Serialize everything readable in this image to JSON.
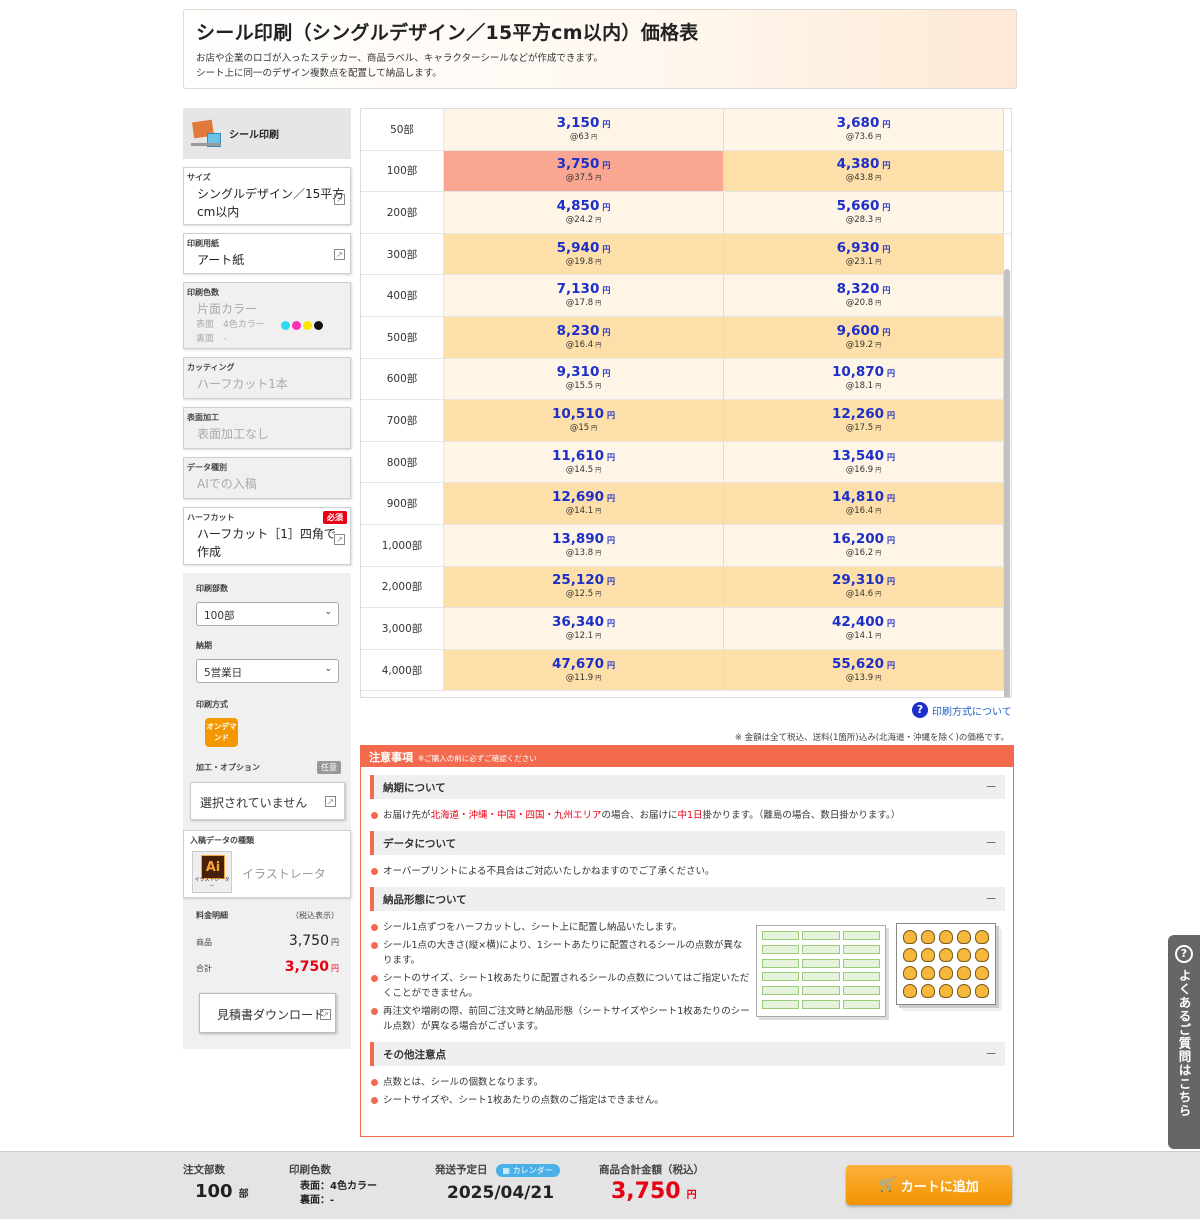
{
  "header": {
    "title": "シール印刷（シングルデザイン／15平方cm以内）価格表",
    "desc1": "お店や企業のロゴが入ったステッカー、商品ラベル、キャラクターシールなどが作成できます。",
    "desc2": "シート上に同一のデザイン複数点を配置して納品します。"
  },
  "sidebar": {
    "title": "シール印刷",
    "size_cap": "サイズ",
    "size_val": "シングルデザイン／15平方cm以内",
    "paper_cap": "印刷用紙",
    "paper_val": "アート紙",
    "color_cap": "印刷色数",
    "color_val": "片面カラー",
    "color_front": "表面　4色カラー",
    "color_back": "裏面　-",
    "cut_cap": "カッティング",
    "cut_val": "ハーフカット1本",
    "surface_cap": "表面加工",
    "surface_val": "表面加工なし",
    "datatype_cap": "データ種別",
    "datatype_val": "AIでの入稿",
    "halfcut_cap": "ハーフカット",
    "halfcut_required": "必須",
    "halfcut_val": "ハーフカット［1］四角で作成",
    "qty_cap": "印刷部数",
    "qty_val": "100部",
    "due_cap": "納期",
    "due_val": "5営業日",
    "method_cap": "印刷方式",
    "method_badge": "オンデマンド",
    "option_cap": "加工・オプション",
    "option_badge": "任意",
    "option_val": "選択されていません",
    "data_kind_cap": "入稿データの種類",
    "ai_icon": "Ai",
    "ai_sub": "イラストレーター",
    "ai_text": "イラストレータ",
    "fee_cap": "料金明細",
    "fee_tax": "（税込表示）",
    "item_label": "商品",
    "item_price": "3,750",
    "total_label": "合計",
    "total_price": "3,750",
    "yen": "円",
    "download_label": "見積書ダウンロード"
  },
  "price_table": {
    "yen": "円",
    "rows": [
      {
        "qty": "50部",
        "a": "3,150",
        "au": "@63",
        "b": "3,680",
        "bu": "@73.6"
      },
      {
        "qty": "100部",
        "a": "3,750",
        "au": "@37.5",
        "b": "4,380",
        "bu": "@43.8"
      },
      {
        "qty": "200部",
        "a": "4,850",
        "au": "@24.2",
        "b": "5,660",
        "bu": "@28.3"
      },
      {
        "qty": "300部",
        "a": "5,940",
        "au": "@19.8",
        "b": "6,930",
        "bu": "@23.1"
      },
      {
        "qty": "400部",
        "a": "7,130",
        "au": "@17.8",
        "b": "8,320",
        "bu": "@20.8"
      },
      {
        "qty": "500部",
        "a": "8,230",
        "au": "@16.4",
        "b": "9,600",
        "bu": "@19.2"
      },
      {
        "qty": "600部",
        "a": "9,310",
        "au": "@15.5",
        "b": "10,870",
        "bu": "@18.1"
      },
      {
        "qty": "700部",
        "a": "10,510",
        "au": "@15",
        "b": "12,260",
        "bu": "@17.5"
      },
      {
        "qty": "800部",
        "a": "11,610",
        "au": "@14.5",
        "b": "13,540",
        "bu": "@16.9"
      },
      {
        "qty": "900部",
        "a": "12,690",
        "au": "@14.1",
        "b": "14,810",
        "bu": "@16.4"
      },
      {
        "qty": "1,000部",
        "a": "13,890",
        "au": "@13.8",
        "b": "16,200",
        "bu": "@16.2"
      },
      {
        "qty": "2,000部",
        "a": "25,120",
        "au": "@12.5",
        "b": "29,310",
        "bu": "@14.6"
      },
      {
        "qty": "3,000部",
        "a": "36,340",
        "au": "@12.1",
        "b": "42,400",
        "bu": "@14.1"
      },
      {
        "qty": "4,000部",
        "a": "47,670",
        "au": "@11.9",
        "b": "55,620",
        "bu": "@13.9"
      }
    ],
    "selected_row": 1
  },
  "help_link": "印刷方式について",
  "tax_note": "※ 金額は全て税込、送料(1箇所)込み(北海道・沖縄を除く)の価格です。",
  "notes": {
    "header": "注意事項",
    "header_sub": "※ご購入の前に必ずご確認ください",
    "sec1_title": "納期について",
    "sec1_pre": "お届け先が",
    "sec1_red1": "北海道・沖縄・中国・四国・九州エリア",
    "sec1_mid": "の場合、お届けに",
    "sec1_red2": "中1日",
    "sec1_post": "掛かります。（離島の場合、数日掛かります。）",
    "sec2_title": "データについて",
    "sec2_item": "オーバープリントによる不具合はご対応いたしかねますのでご了承ください。",
    "sec3_title": "納品形態について",
    "sec3_items": [
      "シール1点ずつをハーフカットし、シート上に配置し納品いたします。",
      "シール1点の大きさ(縦×横)により、1シートあたりに配置されるシールの点数が異なります。",
      "シートのサイズ、シート1枚あたりに配置されるシールの点数についてはご指定いただくことができません。",
      "再注文や増刷の際、前回ご注文時と納品形態（シートサイズやシート1枚あたりのシール点数）が異なる場合がございます。"
    ],
    "sec4_title": "その他注意点",
    "sec4_items": [
      "点数とは、シールの個数となります。",
      "シートサイズや、シート1枚あたりの点数のご指定はできません。"
    ],
    "collapse": "－"
  },
  "help_tab": {
    "icon": "?",
    "label": "よくあるご質問はこちら"
  },
  "footer": {
    "qty_label": "注文部数",
    "qty_value": "100",
    "qty_unit": "部",
    "color_label": "印刷色数",
    "color_front": "表面：4色カラー",
    "color_back": "裏面：-",
    "ship_label": "発送予定日",
    "calendar": "カレンダー",
    "ship_date": "2025/04/21",
    "total_label": "商品合計金額（税込）",
    "total_value": "3,750",
    "total_unit": "円",
    "cart_label": "カートに追加"
  },
  "colors": {
    "accent": "#f26b4f",
    "price_blue": "#1d2fc9",
    "red": "#e60012",
    "cart": "#f29300"
  }
}
